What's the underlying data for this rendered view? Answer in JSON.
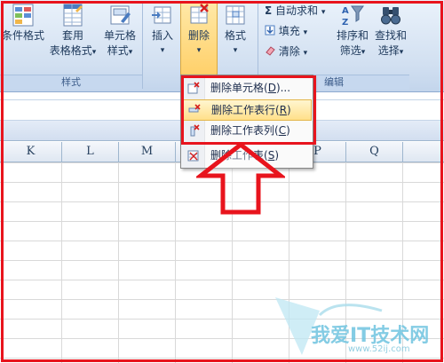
{
  "ribbon": {
    "cond_format": "条件格式",
    "table_format_1": "套用",
    "table_format_2": "表格格式",
    "cell_style_1": "单元格",
    "cell_style_2": "样式",
    "style_group": "样式",
    "insert": "插入",
    "delete": "删除",
    "format": "格式",
    "autosum": "自动求和",
    "fill": "填充",
    "clear": "清除",
    "sort_filter_1": "排序和",
    "sort_filter_2": "筛选",
    "find_select_1": "查找和",
    "find_select_2": "选择",
    "edit_group": "编辑",
    "sigma": "Σ",
    "arrow": "▾"
  },
  "columns": [
    "K",
    "L",
    "M",
    "N",
    "O",
    "P",
    "Q"
  ],
  "menu": {
    "items": [
      {
        "label": "删除单元格(D)...",
        "hotkey": "D"
      },
      {
        "label": "删除工作表行(R)",
        "hotkey": "R"
      },
      {
        "label": "删除工作表列(C)",
        "hotkey": "C"
      },
      {
        "label": "删除工作表(S)",
        "hotkey": "S"
      }
    ]
  },
  "watermark": {
    "brand": "我爱IT技术网",
    "url": "www.52ij.com"
  },
  "colors": {
    "highlight_red": "#e8141d",
    "ribbon_blue": "#d2e0f1"
  }
}
